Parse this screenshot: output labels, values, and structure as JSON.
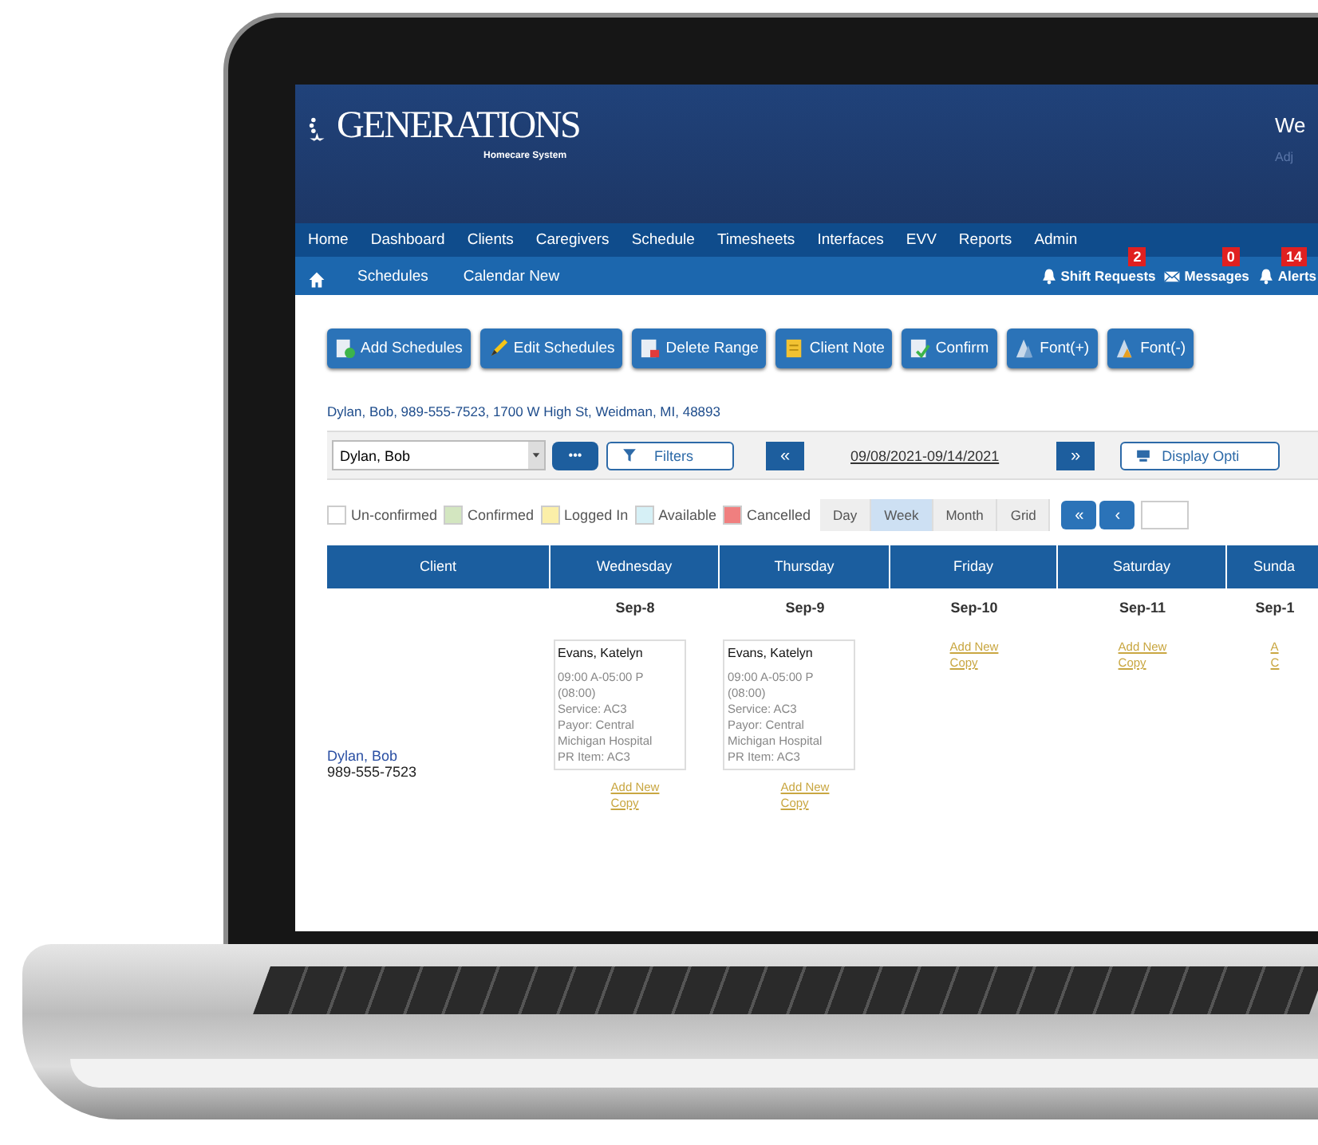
{
  "header": {
    "logo_title": "GENERATIONS",
    "logo_subtitle": "Homecare System",
    "welcome": "We",
    "welcome_sub": "Adj"
  },
  "nav": [
    "Home",
    "Dashboard",
    "Clients",
    "Caregivers",
    "Schedule",
    "Timesheets",
    "Interfaces",
    "EVV",
    "Reports",
    "Admin"
  ],
  "subnav": {
    "links": [
      "Schedules",
      "Calendar New"
    ],
    "notifications": [
      {
        "kind": "bell",
        "label": "Shift Requests",
        "count": "2"
      },
      {
        "kind": "envelope",
        "label": "Messages",
        "count": "0"
      },
      {
        "kind": "bell",
        "label": "Alerts",
        "count": "14"
      }
    ]
  },
  "toolbar": [
    {
      "kind": "add",
      "label": "Add Schedules"
    },
    {
      "kind": "edit",
      "label": "Edit Schedules"
    },
    {
      "kind": "delete",
      "label": "Delete Range"
    },
    {
      "kind": "note",
      "label": "Client Note"
    },
    {
      "kind": "confirm",
      "label": "Confirm"
    },
    {
      "kind": "font_up",
      "label": "Font(+)"
    },
    {
      "kind": "font_down",
      "label": "Font(-)"
    }
  ],
  "client_info": "Dylan, Bob, 989-555-7523, 1700 W High St, Weidman, MI, 48893",
  "controls": {
    "client_select": "Dylan, Bob",
    "more_button": "•••",
    "filters": "Filters",
    "prev": "«",
    "date_range": "09/08/2021-09/14/2021",
    "next": "»",
    "display_options": "Display Opti"
  },
  "legend": [
    {
      "label": "Un-confirmed",
      "color": "#ffffff"
    },
    {
      "label": "Confirmed",
      "color": "#d3e6c0"
    },
    {
      "label": "Logged In",
      "color": "#fbefa8"
    },
    {
      "label": "Available",
      "color": "#d6f0f6"
    },
    {
      "label": "Cancelled",
      "color": "#f07f7f"
    }
  ],
  "view_tabs": [
    {
      "label": "Day",
      "selected": false
    },
    {
      "label": "Week",
      "selected": true
    },
    {
      "label": "Month",
      "selected": false
    },
    {
      "label": "Grid",
      "selected": false
    }
  ],
  "pager": [
    "«",
    "‹"
  ],
  "table": {
    "columns": [
      "Client",
      "Wednesday",
      "Thursday",
      "Friday",
      "Saturday",
      "Sunda"
    ],
    "dates": [
      "Sep-8",
      "Sep-9",
      "Sep-10",
      "Sep-11",
      "Sep-1"
    ],
    "rows": [
      {
        "client": "Dylan, Bob",
        "phone": "989-555-7523",
        "days": [
          {
            "shifts": [
              {
                "caregiver": "Evans, Katelyn",
                "lines": [
                  "09:00 A-05:00 P",
                  "(08:00)",
                  "Service: AC3",
                  "Payor: Central Michigan Hospital",
                  "PR Item: AC3"
                ]
              }
            ],
            "links": [
              "Add New",
              "Copy"
            ]
          },
          {
            "shifts": [
              {
                "caregiver": "Evans, Katelyn",
                "lines": [
                  "09:00 A-05:00 P",
                  "(08:00)",
                  "Service: AC3",
                  "Payor: Central Michigan Hospital",
                  "PR Item: AC3"
                ]
              }
            ],
            "links": [
              "Add New",
              "Copy"
            ]
          },
          {
            "links": [
              "Add New",
              "Copy"
            ]
          },
          {
            "links": [
              "Add New",
              "Copy"
            ]
          },
          {
            "links": [
              "A",
              "C"
            ]
          }
        ]
      }
    ]
  }
}
